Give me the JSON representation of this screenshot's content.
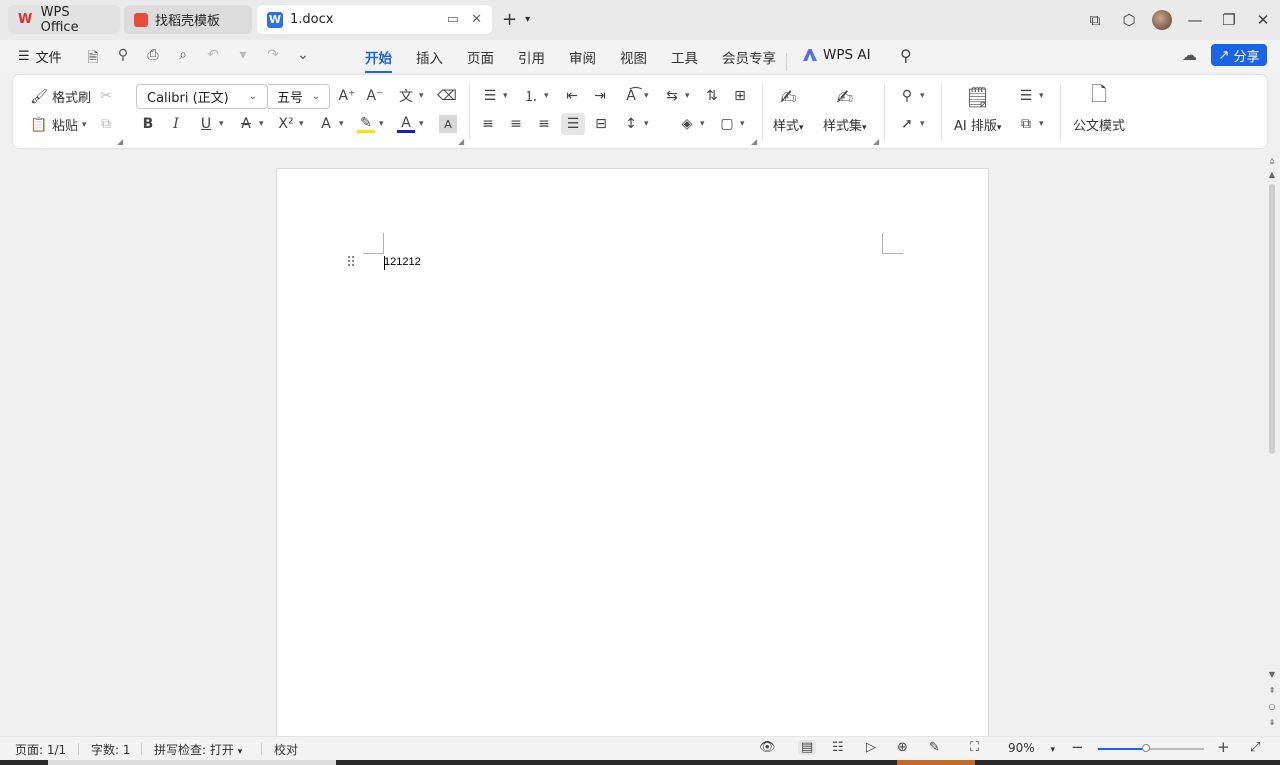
{
  "tabs": [
    {
      "label": "WPS Office",
      "icon": "wps-logo-icon"
    },
    {
      "label": "找稻壳模板",
      "icon": "docer-logo-icon"
    },
    {
      "label": "1.docx",
      "icon": "word-doc-icon"
    }
  ],
  "menu": {
    "file_label": "文件",
    "tabs": [
      "开始",
      "插入",
      "页面",
      "引用",
      "审阅",
      "视图",
      "工具",
      "会员专享"
    ],
    "active_tab": "开始",
    "wps_ai_label": "WPS AI",
    "share_label": "分享"
  },
  "ribbon": {
    "format_painter": "格式刷",
    "paste": "粘贴",
    "font_name": "Calibri (正文)",
    "font_size": "五号",
    "styles": "样式",
    "style_sets": "样式集",
    "ai_layout": "AI 排版",
    "official_mode": "公文模式",
    "font_color": "#1a1ad0",
    "highlight_color": "#f5e400"
  },
  "document": {
    "text": "121212"
  },
  "status": {
    "page": "页面: 1/1",
    "word_count": "字数: 1",
    "spell_check": "拼写检查: 打开",
    "proofread": "校对",
    "zoom": "90%",
    "zoom_level": 0.45
  },
  "colors": {
    "accent": "#1a64e8"
  }
}
